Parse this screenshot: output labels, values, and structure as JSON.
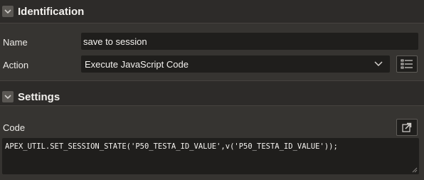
{
  "identification": {
    "title": "Identification",
    "name_label": "Name",
    "name_value": "save to session",
    "action_label": "Action",
    "action_value": "Execute JavaScript Code"
  },
  "settings": {
    "title": "Settings",
    "code_label": "Code",
    "code_value": "APEX_UTIL.SET_SESSION_STATE('P50_TESTA_ID_VALUE',v('P50_TESTA_ID_VALUE'));"
  },
  "icons": {
    "collapse_identification": "chevron-down-icon",
    "collapse_settings": "chevron-down-icon",
    "action_dropdown": "chevron-down-icon",
    "action_list": "list-icon",
    "code_expand": "expand-icon",
    "resize": "resize-handle-icon"
  }
}
